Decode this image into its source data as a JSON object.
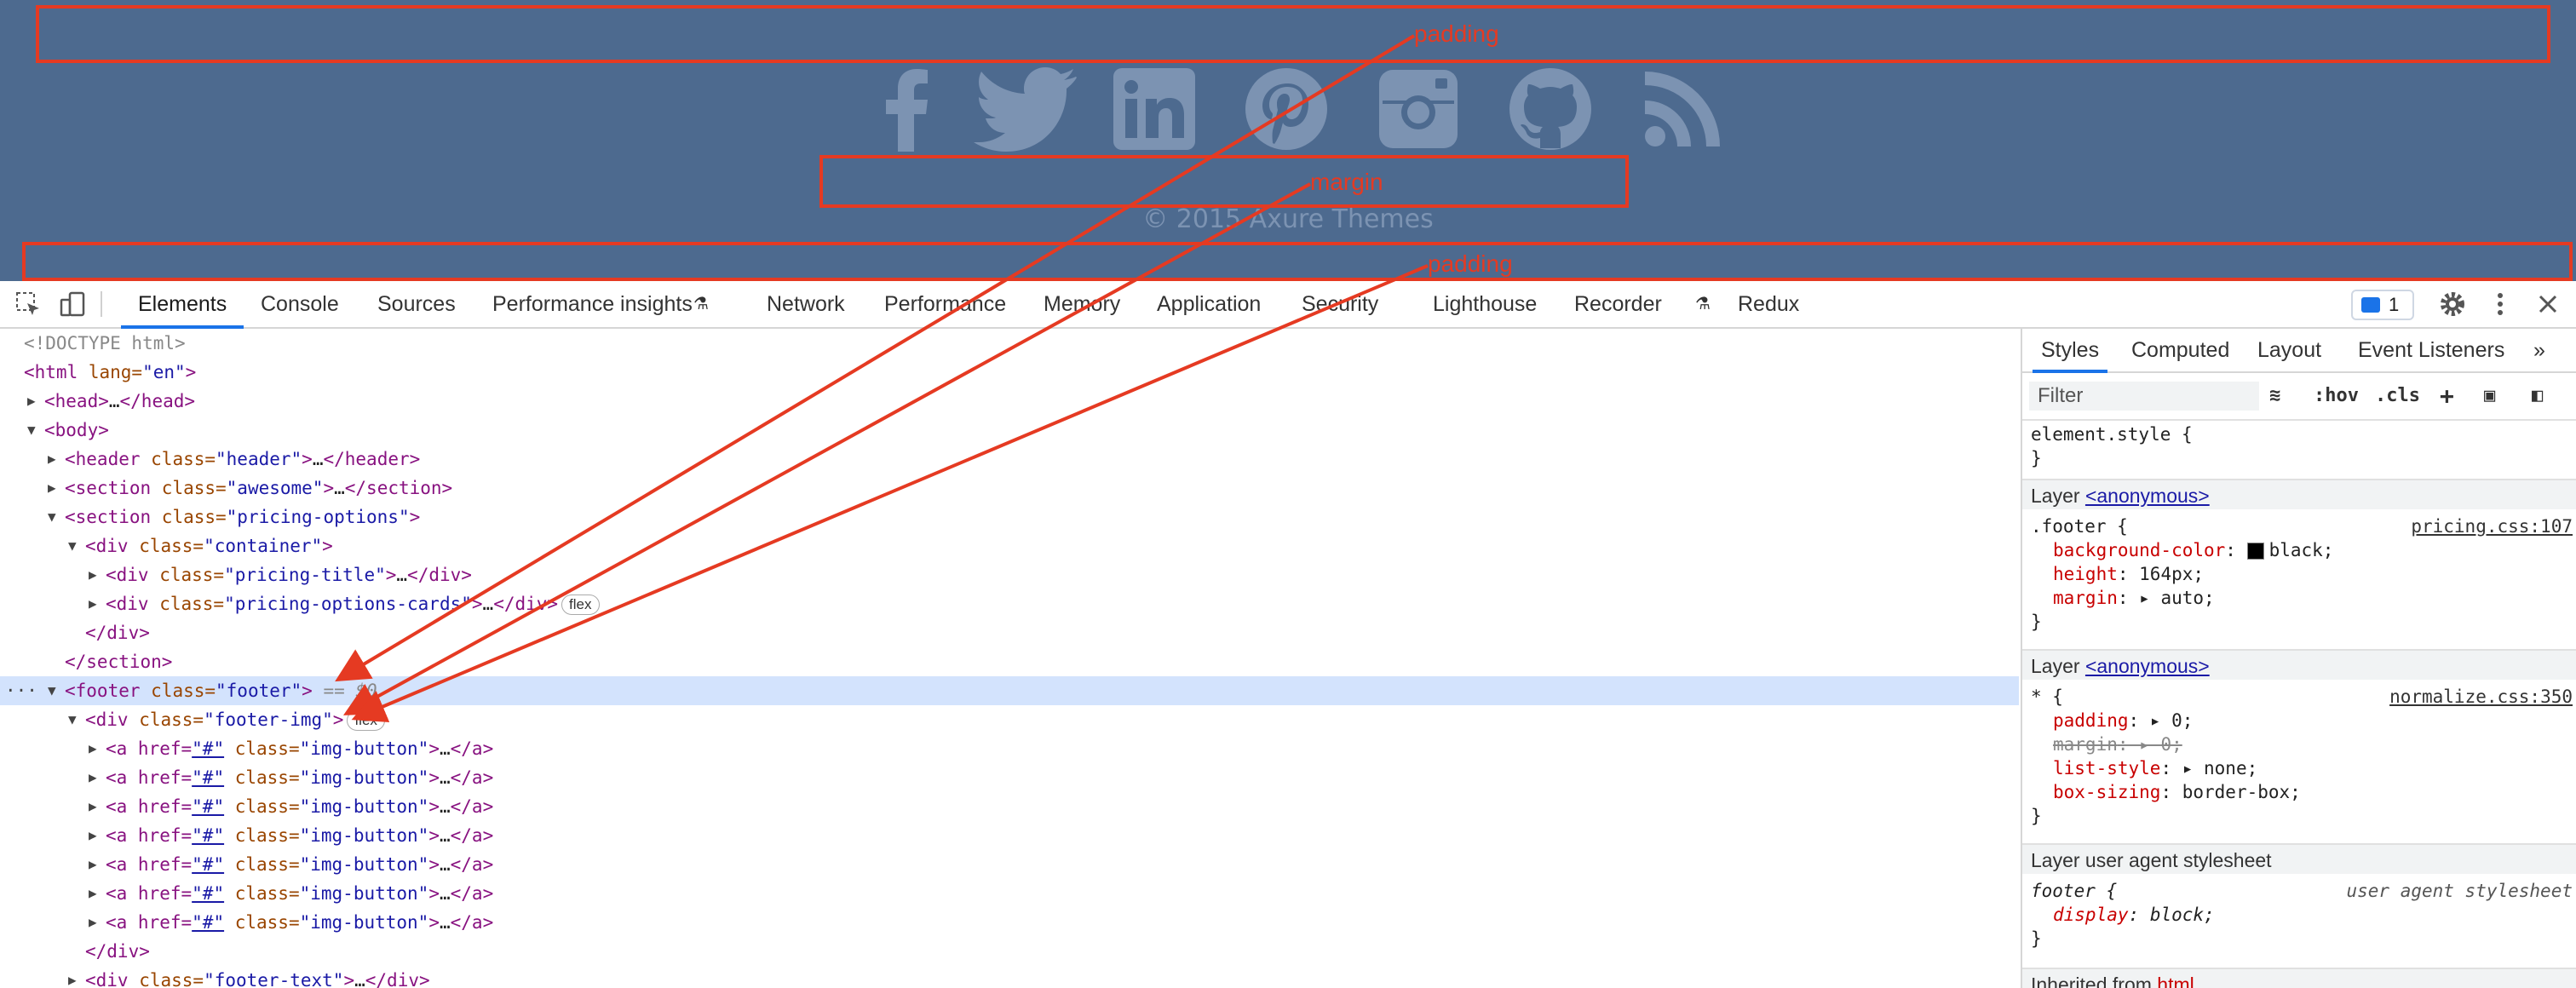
{
  "page": {
    "copyright": "© 2015 Axure Themes",
    "social_icons": [
      "facebook-icon",
      "twitter-icon",
      "linkedin-icon",
      "pinterest-icon",
      "instagram-icon",
      "github-icon",
      "rss-icon"
    ],
    "annotations": [
      "padding",
      "margin",
      "padding"
    ],
    "colors": {
      "footer_bg": "#4d6a8f",
      "icons": "#7c93b2",
      "annotation": "#e53a22"
    }
  },
  "devtools": {
    "tabs": [
      "Elements",
      "Console",
      "Sources",
      "Performance insights",
      "Network",
      "Performance",
      "Memory",
      "Application",
      "Security",
      "Lighthouse",
      "Recorder",
      "Redux"
    ],
    "active_tab": "Elements",
    "issues_count": "1",
    "tree": [
      {
        "text": "<!DOCTYPE html>"
      },
      {
        "tag": "html",
        "attrs": "lang=",
        "val": "\"en\""
      },
      {
        "open": "<head>",
        "ell": "…",
        "close": "</head>"
      },
      {
        "open": "<body>"
      },
      {
        "tag": "header",
        "attr": "class=",
        "val": "\"header\"",
        "ell": "…",
        "close": "</header>"
      },
      {
        "tag": "section",
        "attr": "class=",
        "val": "\"awesome\"",
        "ell": "…",
        "close": "</section>"
      },
      {
        "tag": "section",
        "attr": "class=",
        "val": "\"pricing-options\""
      },
      {
        "tag": "div",
        "attr": "class=",
        "val": "\"container\""
      },
      {
        "tag": "div",
        "attr": "class=",
        "val": "\"pricing-title\"",
        "ell": "…",
        "close": "</div>"
      },
      {
        "tag": "div",
        "attr": "class=",
        "val": "\"pricing-options-cards\"",
        "ell": "…",
        "close": "</div>",
        "badge": "flex"
      },
      {
        "close": "</div>"
      },
      {
        "close": "</section>"
      },
      {
        "tag": "footer",
        "attr": "class=",
        "val": "\"footer\"",
        "eq": "== $0",
        "dots": "···"
      },
      {
        "tag": "div",
        "attr": "class=",
        "val": "\"footer-img\"",
        "badge": "flex"
      },
      {
        "a": "<a href=",
        "href": "\"#\"",
        "attr": " class=",
        "val": "\"img-button\"",
        "ell": "…",
        "close": "</a>"
      },
      {
        "close": "</div>"
      },
      {
        "tag": "div",
        "attr": "class=",
        "val": "\"footer-text\"",
        "ell": "…",
        "close": "</div>"
      }
    ],
    "styles_tabs": [
      "Styles",
      "Computed",
      "Layout",
      "Event Listeners"
    ],
    "filter_placeholder": "Filter",
    "filter_buttons": [
      ":hov",
      ".cls"
    ],
    "rules": {
      "element_style": "element.style {",
      "close": "}",
      "layer_anon": "Layer",
      "layer_anon_link": "<anonymous>",
      "footer_selector": ".footer {",
      "footer_source": "pricing.css:107",
      "footer_props": [
        {
          "name": "background-color",
          "value": "black;"
        },
        {
          "name": "height",
          "value": "164px;"
        },
        {
          "name": "margin",
          "value": "auto;"
        }
      ],
      "star_selector": "* {",
      "star_source": "normalize.css:350",
      "star_props": [
        {
          "name": "padding",
          "value": "0;"
        },
        {
          "name": "margin",
          "value": "0;"
        },
        {
          "name": "list-style",
          "value": "none;"
        },
        {
          "name": "box-sizing",
          "value": "border-box;"
        }
      ],
      "layer_ua": "Layer user agent stylesheet",
      "ua_selector": "footer {",
      "ua_source": "user agent stylesheet",
      "ua_prop": {
        "name": "display",
        "value": "block;"
      },
      "inherited": "Inherited from",
      "inherited_link": "html"
    }
  }
}
